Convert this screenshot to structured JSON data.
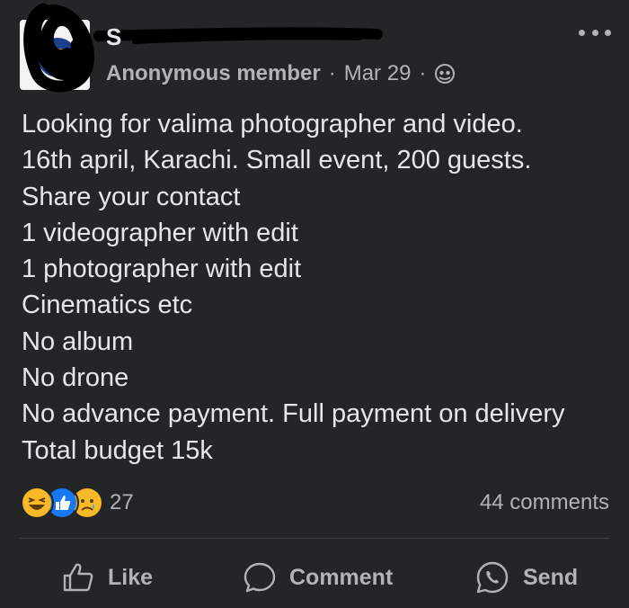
{
  "post": {
    "group_name": "S",
    "author": "Anonymous member",
    "date": "Mar 29",
    "separator": "·",
    "privacy_icon": "anonymous-icon",
    "body_lines": [
      "Looking for valima photographer and video.",
      "16th april, Karachi. Small event, 200 guests.",
      "Share your contact",
      "1 videographer with edit",
      "1 photographer with edit",
      "Cinematics etc",
      "No album",
      "No drone",
      "No advance payment. Full payment on delivery",
      "Total budget 15k"
    ]
  },
  "engagement": {
    "reaction_icons": [
      "haha-icon",
      "like-icon",
      "sad-icon"
    ],
    "reaction_count": "27",
    "comments_label": "44 comments"
  },
  "actions": {
    "like": "Like",
    "comment": "Comment",
    "send": "Send"
  },
  "colors": {
    "background": "#242526",
    "primary_text": "#e4e6eb",
    "secondary_text": "#b0b3b8",
    "like_blue": "#1877f2",
    "reaction_yellow": "#f7b928"
  }
}
